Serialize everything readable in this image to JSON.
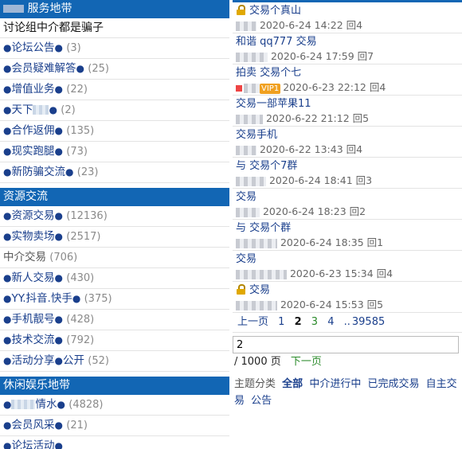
{
  "left": {
    "sections": [
      {
        "title": "服务地带",
        "subtitle": "讨论组中介都是骗子",
        "items": [
          {
            "label": "论坛公告",
            "count": "(3)"
          },
          {
            "label": "会员疑难解答",
            "count": "(25)"
          },
          {
            "label": "增值业务",
            "count": "(22)"
          },
          {
            "label": "天下",
            "count": "(2)"
          },
          {
            "label": "合作返佣",
            "count": "(135)"
          },
          {
            "label": "现实跑腿",
            "count": "(73)"
          },
          {
            "label": "新防骗交流",
            "count": "(23)"
          }
        ]
      },
      {
        "title": "资源交流",
        "items": [
          {
            "label": "资源交易",
            "count": "(12136)"
          },
          {
            "label": "实物卖场",
            "count": "(2517)"
          },
          {
            "label": "中介交易",
            "count": "(706)",
            "plain": true
          },
          {
            "label": "新人交易",
            "count": "(430)"
          },
          {
            "label": "YY.抖音.快手",
            "count": "(375)"
          },
          {
            "label": "手机靓号",
            "count": "(428)"
          },
          {
            "label": "技术交流",
            "count": "(792)"
          },
          {
            "label": "活动分享",
            "extra": "公开",
            "count": "(52)"
          }
        ]
      },
      {
        "title": "休闲娱乐地带",
        "items": [
          {
            "label": "情水",
            "count": "(4828)"
          },
          {
            "label": "会员风采",
            "count": "(21)"
          },
          {
            "label": "论坛活动",
            "count": ""
          }
        ]
      }
    ]
  },
  "right": {
    "topics": [
      {
        "title": "交易个真山",
        "meta": "2020-6-24 14:22 回4",
        "lock": true
      },
      {
        "title": "和谐 qq777 交易",
        "meta": "2020-6-24 17:59 回7"
      },
      {
        "title": "拍卖 交易个七",
        "meta": "2020-6-23 22:12 回4",
        "vip": "VIP1"
      },
      {
        "title": "交易一部苹果11",
        "meta": "2020-6-22 21:12 回5"
      },
      {
        "title": "交易手机",
        "meta": "2020-6-22 13:43 回4"
      },
      {
        "title": "与 交易个7群",
        "meta": "2020-6-24 18:41 回3"
      },
      {
        "title": "交易",
        "meta": "2020-6-24 18:23 回2"
      },
      {
        "title": "与 交易个群",
        "meta": "2020-6-24 18:35 回1"
      },
      {
        "title": "交易",
        "meta": "2020-6-23 15:34 回4"
      },
      {
        "title": "交易",
        "meta": "2020-6-24 15:53 回5",
        "lock": true
      }
    ],
    "pager": {
      "prev": "上一页",
      "p1": "1",
      "p2": "2",
      "p3": "3",
      "p4": "4",
      "dots": "..",
      "last": "39585"
    },
    "page_input_value": "2",
    "total": "/ 1000 页",
    "next": "下一页",
    "categories_label": "主题分类",
    "categories": [
      "全部",
      "中介进行中",
      "已完成交易",
      "自主交易",
      "公告"
    ]
  }
}
